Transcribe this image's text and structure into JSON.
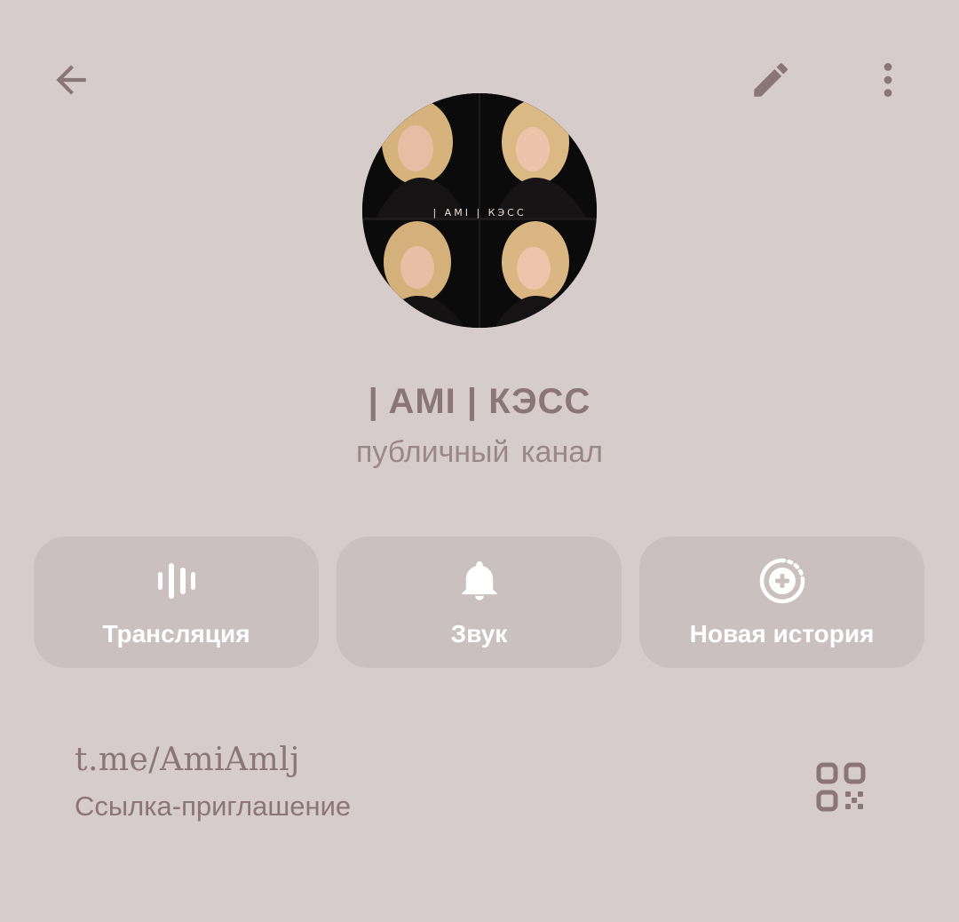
{
  "header": {
    "back_icon": "arrow-left-icon",
    "edit_icon": "pencil-icon",
    "more_icon": "more-vertical-icon"
  },
  "profile": {
    "avatar_text": "| AMI | КЭСС",
    "name": "| AMI | КЭСС",
    "type": "публичный канал"
  },
  "actions": [
    {
      "label": "Трансляция",
      "icon": "live-stream-icon"
    },
    {
      "label": "Звук",
      "icon": "bell-icon"
    },
    {
      "label": "Новая история",
      "icon": "add-story-icon"
    }
  ],
  "invite": {
    "link": "t.me/AmiAmlj",
    "caption": "Ссылка-приглашение",
    "qr_icon": "qr-code-icon"
  },
  "colors": {
    "background": "#d7cccc",
    "button_bg": "#cbc0c0",
    "text_accent": "#8a7676",
    "button_text": "#ffffff"
  }
}
